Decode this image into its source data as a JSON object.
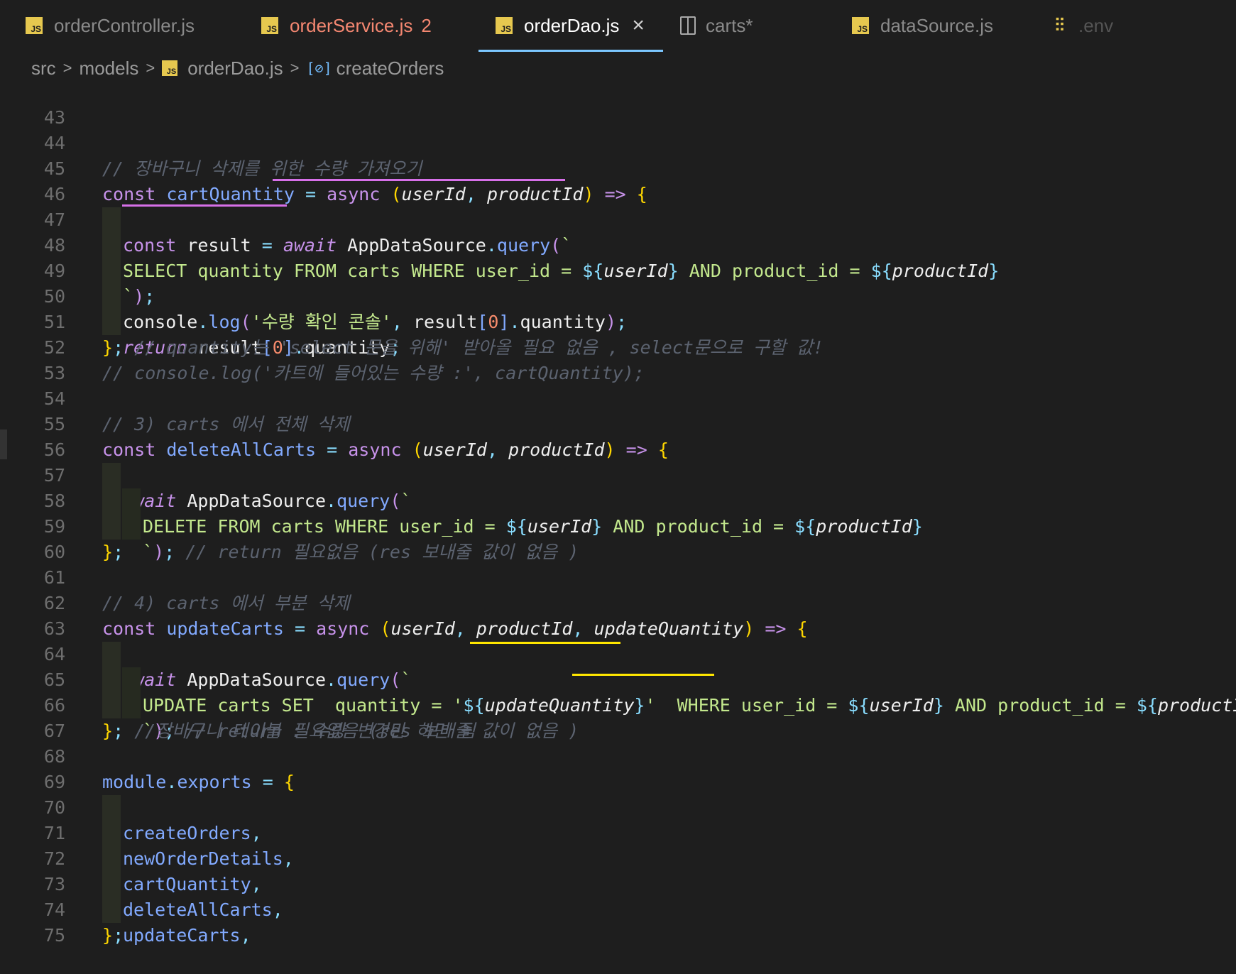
{
  "tabs": [
    {
      "label": "orderController.js",
      "icon": "js-file-icon"
    },
    {
      "label": "orderService.js",
      "badge": "2",
      "icon": "js-file-icon"
    },
    {
      "label": "orderDao.js",
      "icon": "js-file-icon",
      "active": true
    },
    {
      "label": "carts*",
      "icon": "split-editor-icon"
    },
    {
      "label": "dataSource.js",
      "icon": "js-file-icon"
    },
    {
      "label": ".env",
      "icon": "settings-sliders-icon"
    }
  ],
  "breadcrumb": {
    "parts": [
      "src",
      "models",
      "orderDao.js",
      "createOrders"
    ]
  },
  "code": {
    "lines": [
      {
        "n": "43"
      },
      {
        "n": "44"
      },
      {
        "n": "45"
      },
      {
        "n": "46"
      },
      {
        "n": "47"
      },
      {
        "n": "48"
      },
      {
        "n": "49"
      },
      {
        "n": "50"
      },
      {
        "n": "51"
      },
      {
        "n": "52"
      },
      {
        "n": "53"
      },
      {
        "n": "54"
      },
      {
        "n": "55"
      },
      {
        "n": "56"
      },
      {
        "n": "57"
      },
      {
        "n": "58"
      },
      {
        "n": "59"
      },
      {
        "n": "60"
      },
      {
        "n": "61"
      },
      {
        "n": "62"
      },
      {
        "n": "63"
      },
      {
        "n": "64"
      },
      {
        "n": "65"
      },
      {
        "n": "66"
      },
      {
        "n": "67"
      },
      {
        "n": "68"
      },
      {
        "n": "69"
      },
      {
        "n": "70"
      },
      {
        "n": "71"
      },
      {
        "n": "72"
      },
      {
        "n": "73"
      },
      {
        "n": "74"
      },
      {
        "n": "75"
      }
    ],
    "comments": {
      "c44": "// 장바구니 삭제를 위한 수량 가져오기",
      "c51": "// quantity는 'select 문을 위해' 받아올 필요 없음 , select문으로 구할 값!",
      "c52": "// console.log('카트에 들어있는 수량 :', cartQuantity);",
      "c54": "// 3) carts 에서 전체 삭제",
      "c58": "// return 필요없음 (res 보내줄 값이 없음 )",
      "c61": "// 4) carts 에서 부분 삭제",
      "c65": "// return 필요없음 (res 보내줄 값이 없음 )",
      "c66": "//장바구니 테이블 : 수량 변경만 하면 됨"
    },
    "strings": {
      "s47": "SELECT quantity FROM carts WHERE user_id = ",
      "s47b": " AND product_id = ",
      "s49": "'수량 확인 콘솔'",
      "s57": "DELETE FROM carts WHERE user_id = ",
      "s57b": " AND product_id = ",
      "s64a": "UPDATE carts SET  quantity = '",
      "s64b": "'  WHERE user_id = ",
      "s64c": " AND product_id = "
    },
    "exports": [
      "createOrders",
      "newOrderDetails",
      "cartQuantity",
      "deleteAllCarts",
      "updateCarts"
    ]
  },
  "colors": {
    "background": "#1e1e1e",
    "active_tab_underline": "#7cc7ff",
    "error_tab": "#f48771",
    "pink_underline": "#d670e8",
    "yellow_underline": "#ffe600"
  }
}
